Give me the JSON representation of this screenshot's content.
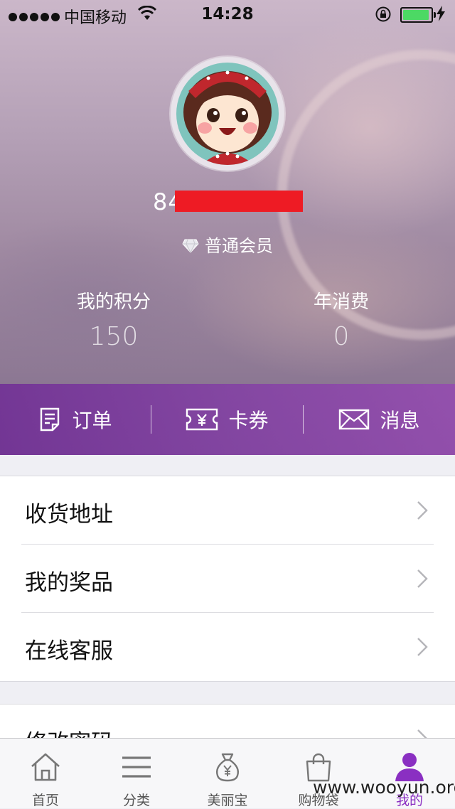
{
  "status_bar": {
    "carrier": "中国移动",
    "time": "14:28",
    "battery_level": 0.95
  },
  "profile": {
    "username_visible": "84",
    "member_level": "普通会员"
  },
  "stats": [
    {
      "label": "我的积分",
      "value": "150"
    },
    {
      "label": "年消费",
      "value": "0"
    }
  ],
  "actions": [
    {
      "label": "订单",
      "icon": "order-icon"
    },
    {
      "label": "卡券",
      "icon": "coupon-icon"
    },
    {
      "label": "消息",
      "icon": "message-icon"
    }
  ],
  "menu_group_1": [
    {
      "label": "收货地址"
    },
    {
      "label": "我的奖品"
    },
    {
      "label": "在线客服"
    }
  ],
  "menu_group_2": [
    {
      "label": "修改密码"
    }
  ],
  "tabbar": [
    {
      "label": "首页",
      "icon": "home-icon"
    },
    {
      "label": "分类",
      "icon": "menu-icon"
    },
    {
      "label": "美丽宝",
      "icon": "money-bag-icon"
    },
    {
      "label": "购物袋",
      "icon": "shopping-bag-icon"
    },
    {
      "label": "我的",
      "icon": "user-icon",
      "active": true
    }
  ],
  "watermark": "www.wooyun.org",
  "colors": {
    "accent": "#8a2fc2",
    "action_bar": "#7a2fa6",
    "battery": "#4cd964"
  }
}
